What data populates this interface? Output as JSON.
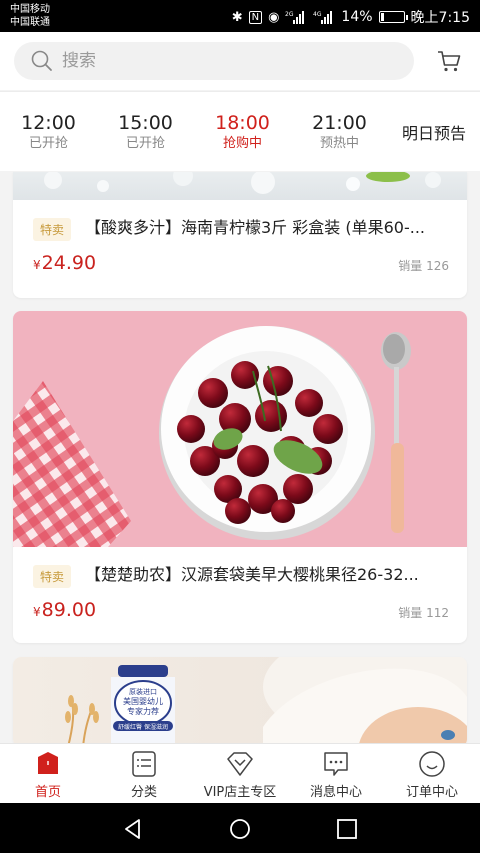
{
  "status": {
    "carrier1": "中国移动",
    "carrier2": "中国联通",
    "battery": "14%",
    "battery_level": 0.14,
    "time": "晚上7:15",
    "net1": "2G",
    "net2": "4G"
  },
  "search": {
    "placeholder": "搜索"
  },
  "tabs": [
    {
      "time": "12:00",
      "state": "已开抢"
    },
    {
      "time": "15:00",
      "state": "已开抢"
    },
    {
      "time": "18:00",
      "state": "抢购中",
      "active": true
    },
    {
      "time": "21:00",
      "state": "预热中"
    }
  ],
  "tab_preview": "明日预告",
  "products": [
    {
      "tag": "特卖",
      "title": "【酸爽多汁】海南青柠檬3斤 彩盒装 (单果60-...",
      "currency": "¥",
      "price": "24.90",
      "sales": "销量 126"
    },
    {
      "tag": "特卖",
      "title": "【楚楚助农】汉源套袋美早大樱桃果径26-32...",
      "currency": "¥",
      "price": "89.00",
      "sales": "销量 112"
    }
  ],
  "milk_image_text": {
    "line1": "原装进口",
    "line2": "美国婴幼儿",
    "line3": "专家力荐",
    "line4": "舒缓红臀 保湿滋润"
  },
  "bottom_nav": [
    {
      "label": "首页",
      "icon": "home-icon"
    },
    {
      "label": "分类",
      "icon": "list-icon"
    },
    {
      "label": "VIP店主专区",
      "icon": "diamond-icon"
    },
    {
      "label": "消息中心",
      "icon": "message-icon"
    },
    {
      "label": "订单中心",
      "icon": "smile-icon"
    }
  ],
  "colors": {
    "accent": "#d0211c",
    "tag_bg": "#fbf3e2",
    "tag_text": "#c79a3c"
  }
}
